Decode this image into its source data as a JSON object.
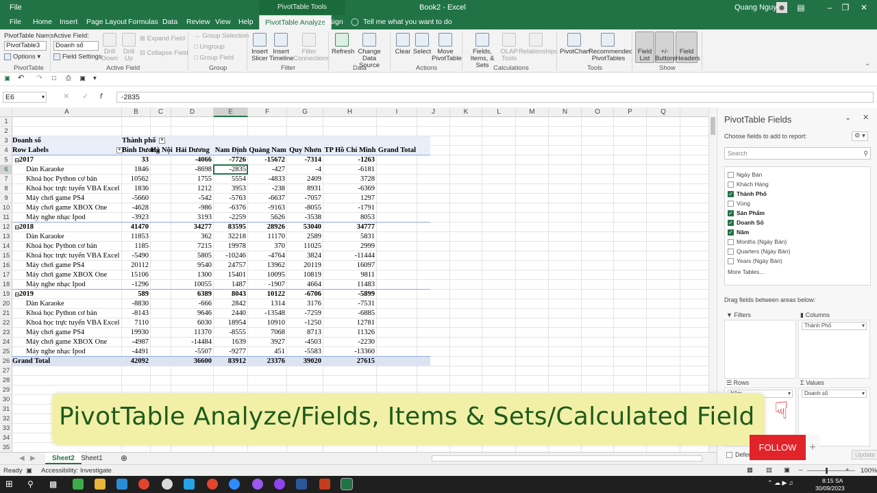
{
  "titlebar": {
    "file_name": "Book2 - Excel",
    "context_tools": "PivotTable Tools",
    "user": "Quang Nguyen"
  },
  "menu": {
    "tabs": [
      "File",
      "Home",
      "Insert",
      "Page Layout",
      "Formulas",
      "Data",
      "Review",
      "View",
      "Help"
    ],
    "active_tab": "PivotTable Analyze",
    "design_tab": "Design",
    "tell_me": "Tell me what you want to do"
  },
  "ribbon": {
    "pivottable": {
      "name_label": "PivotTable Name:",
      "name_value": "PivotTable3",
      "options": "Options",
      "group": "PivotTable"
    },
    "active_field": {
      "label": "Active Field:",
      "value": "Doanh số",
      "field_settings": "Field Settings",
      "drill_down": "Drill Down",
      "drill_up": "Drill Up",
      "expand": "Expand Field",
      "collapse": "Collapse Field",
      "group": "Active Field"
    },
    "group_grp": {
      "group_selection": "Group Selection",
      "ungroup": "Ungroup",
      "group_field": "Group Field",
      "group": "Group"
    },
    "filter": {
      "slicer": "Insert Slicer",
      "timeline": "Insert Timeline",
      "connections": "Filter Connections",
      "group": "Filter"
    },
    "data": {
      "refresh": "Refresh",
      "change_source": "Change Data Source",
      "group": "Data"
    },
    "actions": {
      "clear": "Clear",
      "select": "Select",
      "move": "Move PivotTable",
      "group": "Actions"
    },
    "calculations": {
      "fields": "Fields, Items, & Sets",
      "olap": "OLAP Tools",
      "relationships": "Relationships",
      "group": "Calculations"
    },
    "tools": {
      "pivotchart": "PivotChart",
      "recommended": "Recommended PivotTables",
      "group": "Tools"
    },
    "show": {
      "field_list": "Field List",
      "buttons": "+/- Buttons",
      "headers": "Field Headers",
      "group": "Show"
    }
  },
  "formula_bar": {
    "name_box": "E6",
    "formula": "-2835"
  },
  "grid": {
    "columns": [
      "A",
      "B",
      "C",
      "D",
      "E",
      "F",
      "G",
      "H",
      "I",
      "J",
      "K",
      "L",
      "M",
      "N",
      "O",
      "P",
      "Q"
    ],
    "selected_column": "E",
    "rows": [
      "1",
      "2",
      "3",
      "4",
      "5",
      "6",
      "7",
      "8",
      "9",
      "10",
      "11",
      "12",
      "13",
      "14",
      "15",
      "16",
      "17",
      "18",
      "19",
      "20",
      "21",
      "22",
      "23",
      "24",
      "25",
      "26",
      "27",
      "28",
      "29",
      "30",
      "31",
      "32",
      "33",
      "34",
      "35"
    ],
    "selected_row": "6"
  },
  "pivot": {
    "value_field": "Doanh số",
    "column_field": "Thành phố",
    "row_labels": "Row Labels",
    "headers": [
      "Bình Dương",
      "Hà Nội",
      "Hải Dương",
      "Nam Định",
      "Quảng Nam",
      "Quy Nhơn",
      "TP Hồ Chí Minh",
      "Grand Total"
    ],
    "rows": [
      {
        "label": "2017",
        "level": 0,
        "values": [
          "33",
          "",
          "-4066",
          "-7726",
          "-15672",
          "-7314",
          "-1263",
          ""
        ]
      },
      {
        "label": "Dàn Karaoke",
        "level": 1,
        "values": [
          "1846",
          "",
          "-8698",
          "-2835",
          "-427",
          "-4",
          "-6181",
          ""
        ]
      },
      {
        "label": "Khoá học Python cơ bản",
        "level": 1,
        "values": [
          "10562",
          "",
          "1755",
          "5554",
          "-4833",
          "2409",
          "3728",
          ""
        ]
      },
      {
        "label": "Khoá học trực tuyến VBA Excel",
        "level": 1,
        "values": [
          "1836",
          "",
          "1212",
          "3953",
          "-238",
          "8931",
          "-6369",
          ""
        ]
      },
      {
        "label": "Máy chơi game PS4",
        "level": 1,
        "values": [
          "-5660",
          "",
          "-542",
          "-5763",
          "-6637",
          "-7057",
          "1297",
          ""
        ]
      },
      {
        "label": "Máy chơi game XBOX One",
        "level": 1,
        "values": [
          "-4628",
          "",
          "-986",
          "-6376",
          "-9163",
          "-8055",
          "-1791",
          ""
        ]
      },
      {
        "label": "Máy nghe nhạc Ipod",
        "level": 1,
        "values": [
          "-3923",
          "",
          "3193",
          "-2259",
          "5626",
          "-3538",
          "8053",
          ""
        ]
      },
      {
        "label": "2018",
        "level": 0,
        "values": [
          "41470",
          "",
          "34277",
          "83595",
          "28926",
          "53040",
          "34777",
          ""
        ]
      },
      {
        "label": "Dàn Karaoke",
        "level": 1,
        "values": [
          "11853",
          "",
          "362",
          "32218",
          "11170",
          "2589",
          "5831",
          ""
        ]
      },
      {
        "label": "Khoá học Python cơ bản",
        "level": 1,
        "values": [
          "1185",
          "",
          "7215",
          "19978",
          "370",
          "11025",
          "2999",
          ""
        ]
      },
      {
        "label": "Khoá học trực tuyến VBA Excel",
        "level": 1,
        "values": [
          "-5490",
          "",
          "5805",
          "-10246",
          "-4764",
          "3824",
          "-11444",
          ""
        ]
      },
      {
        "label": "Máy chơi game PS4",
        "level": 1,
        "values": [
          "20112",
          "",
          "9540",
          "24757",
          "13962",
          "20119",
          "16097",
          ""
        ]
      },
      {
        "label": "Máy chơi game XBOX One",
        "level": 1,
        "values": [
          "15106",
          "",
          "1300",
          "15401",
          "10095",
          "10819",
          "9811",
          ""
        ]
      },
      {
        "label": "Máy nghe nhạc Ipod",
        "level": 1,
        "values": [
          "-1296",
          "",
          "10055",
          "1487",
          "-1907",
          "4664",
          "11483",
          ""
        ]
      },
      {
        "label": "2019",
        "level": 0,
        "values": [
          "589",
          "",
          "6389",
          "8043",
          "10122",
          "-6706",
          "-5899",
          ""
        ]
      },
      {
        "label": "Dàn Karaoke",
        "level": 1,
        "values": [
          "-8830",
          "",
          "-666",
          "2842",
          "1314",
          "3176",
          "-7531",
          ""
        ]
      },
      {
        "label": "Khoá học Python cơ bản",
        "level": 1,
        "values": [
          "-8143",
          "",
          "9646",
          "2440",
          "-13548",
          "-7259",
          "-6885",
          ""
        ]
      },
      {
        "label": "Khoá học trực tuyến VBA Excel",
        "level": 1,
        "values": [
          "7110",
          "",
          "6030",
          "18954",
          "10910",
          "-1250",
          "12781",
          ""
        ]
      },
      {
        "label": "Máy chơi game PS4",
        "level": 1,
        "values": [
          "19930",
          "",
          "11370",
          "-8555",
          "7068",
          "8713",
          "11326",
          ""
        ]
      },
      {
        "label": "Máy chơi game XBOX One",
        "level": 1,
        "values": [
          "-4987",
          "",
          "-14484",
          "1639",
          "3927",
          "-4503",
          "-2230",
          ""
        ]
      },
      {
        "label": "Máy nghe nhạc Ipod",
        "level": 1,
        "values": [
          "-4491",
          "",
          "-5507",
          "-9277",
          "451",
          "-5583",
          "-13360",
          ""
        ]
      },
      {
        "label": "Grand Total",
        "level": 2,
        "values": [
          "42092",
          "",
          "36600",
          "83912",
          "23376",
          "39020",
          "27615",
          ""
        ]
      }
    ]
  },
  "sheet_tabs": [
    "Sheet2",
    "Sheet1"
  ],
  "status": {
    "ready": "Ready",
    "accessibility": "Accessibility: Investigate",
    "zoom": "100%"
  },
  "pane": {
    "title": "PivotTable Fields",
    "subtitle": "Choose fields to add to report:",
    "search_placeholder": "Search",
    "fields": [
      {
        "name": "Ngày Bán",
        "checked": false
      },
      {
        "name": "Khách Hàng",
        "checked": false
      },
      {
        "name": "Thành Phố",
        "checked": true
      },
      {
        "name": "Vùng",
        "checked": false
      },
      {
        "name": "Sản Phẩm",
        "checked": true
      },
      {
        "name": "Doanh Số",
        "checked": true
      },
      {
        "name": "Năm",
        "checked": true
      },
      {
        "name": "Months (Ngày Bán)",
        "checked": false
      },
      {
        "name": "Quarters (Ngày Bán)",
        "checked": false
      },
      {
        "name": "Years (Ngày Bán)",
        "checked": false
      }
    ],
    "more_tables": "More Tables...",
    "drag_hint": "Drag fields between areas below:",
    "filters": "Filters",
    "columns": "Columns",
    "rows": "Rows",
    "values": "Values",
    "columns_item": "Thành Phố",
    "rows_item": "Năm",
    "values_item": "Doanh số",
    "defer": "Defer",
    "update": "Update"
  },
  "banner": {
    "text": "PivotTable Analyze/Fields, Items & Sets/Calculated Field"
  },
  "follow": {
    "label": "FOLLOW"
  },
  "taskbar": {
    "time": "8:15 SA",
    "date": "30/09/2023"
  },
  "colors": {
    "excel_green": "#217346",
    "pivot_band": "#dce4f2",
    "follow_red": "#e2232a",
    "banner_bg": "#f2f0a6"
  }
}
